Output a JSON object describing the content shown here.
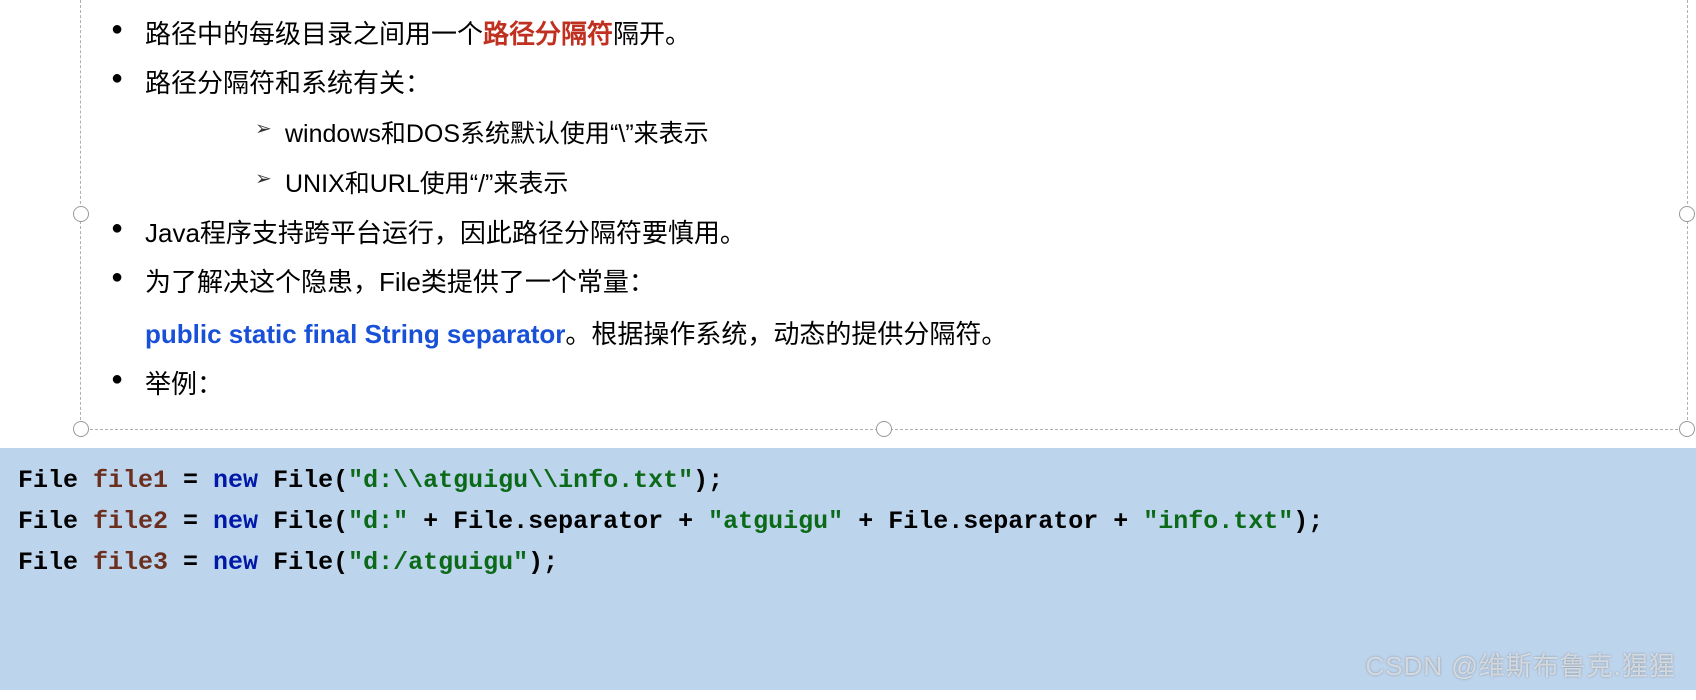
{
  "bullets": {
    "b1_pre": "路径中的每级目录之间用一个",
    "b1_hl": "路径分隔符",
    "b1_post": "隔开。",
    "b2": "路径分隔符和系统有关：",
    "b2_sub1": "windows和DOS系统默认使用“\\”来表示",
    "b2_sub2": "UNIX和URL使用“/”来表示",
    "b3": "Java程序支持跨平台运行，因此路径分隔符要慎用。",
    "b4": "为了解决这个隐患，File类提供了一个常量：",
    "b4_line_blue": "public  static final String separator",
    "b4_line_rest": "。根据操作系统，动态的提供分隔符。",
    "b5": "举例："
  },
  "code": {
    "l1": {
      "t1": "File ",
      "var": "file1",
      "eq": " = ",
      "kw": "new",
      "call": " File(",
      "str": "\"d:\\\\atguigu\\\\info.txt\"",
      "end": ");"
    },
    "l2": {
      "t1": "File ",
      "var": "file2",
      "eq": " = ",
      "kw": "new",
      "call": " File(",
      "s1": "\"d:\"",
      "p1": " + File.separator + ",
      "s2": "\"atguigu\"",
      "p2": " + File.separator + ",
      "s3": "\"info.txt\"",
      "end": ");"
    },
    "l3": {
      "t1": "File ",
      "var": "file3",
      "eq": " = ",
      "kw": "new",
      "call": " File(",
      "str": "\"d:/atguigu\"",
      "end": ");"
    }
  },
  "watermark": "CSDN @维斯布鲁克.猩猩"
}
